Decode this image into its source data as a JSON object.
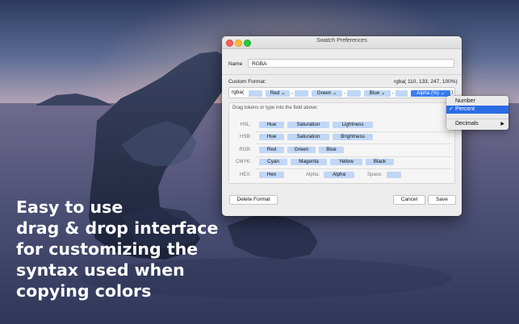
{
  "headline": {
    "lines": [
      "Easy to use",
      "drag & drop interface",
      "for customizing the",
      "syntax used when",
      "copying colors"
    ]
  },
  "window": {
    "title": "Swatch Preferences",
    "name_label": "Name",
    "name_value": "RGBA",
    "custom_format_label": "Custom Format:",
    "preview": "rgba( 110, 133, 247, 100%)",
    "format_tokens": {
      "prefix": "rgba(",
      "red": "Red",
      "green": "Green",
      "blue": "Blue",
      "alpha": "Alpha (%)",
      "comma": ",",
      "close": ")",
      "dropdown_glyph": "⌄"
    },
    "hint": "Drag tokens or type into the field above:",
    "rows": {
      "hsl": {
        "label": "HSL:",
        "tokens": [
          "Hue",
          "Saturation",
          "Lightness"
        ]
      },
      "hsb": {
        "label": "HSB:",
        "tokens": [
          "Hue",
          "Saturation",
          "Brightness"
        ]
      },
      "rgb": {
        "label": "RGB:",
        "tokens": [
          "Red",
          "Green",
          "Blue"
        ]
      },
      "cmyk": {
        "label": "CMYK:",
        "tokens": [
          "Cyan",
          "Magenta",
          "Yellow",
          "Black"
        ]
      },
      "hex": {
        "label": "HEX:",
        "token": "Hex",
        "alpha_label": "Alpha:",
        "alpha_token": "Alpha",
        "space_label": "Space:"
      }
    },
    "buttons": {
      "delete": "Delete Format",
      "cancel": "Cancel",
      "save": "Save"
    }
  },
  "menu": {
    "items": [
      "Number",
      "Percent",
      "Decimals"
    ],
    "checked": "Percent",
    "check_glyph": "✓",
    "submenu_glyph": "▶"
  },
  "colors": {
    "token_bg": "#c0d6f6",
    "token_selected": "#3b7cf1",
    "menu_highlight": "#2b6be6"
  }
}
